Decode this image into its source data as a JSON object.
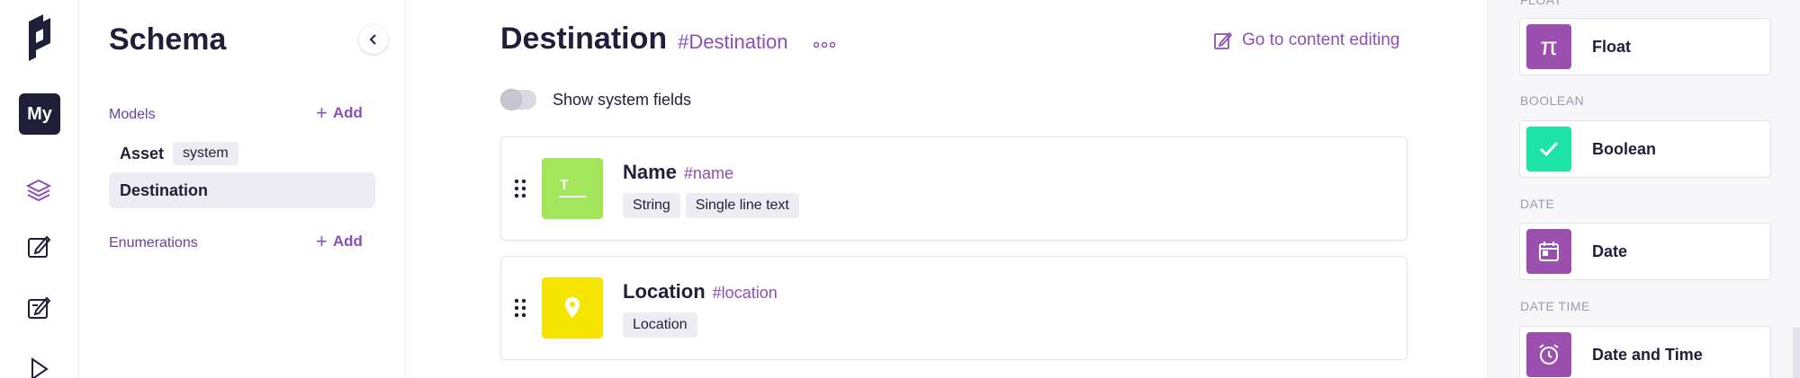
{
  "project": {
    "avatar_text": "My"
  },
  "schema": {
    "title": "Schema",
    "models_label": "Models",
    "enumerations_label": "Enumerations",
    "add_label": "Add",
    "models": [
      {
        "name": "Asset",
        "badge": "system",
        "active": false
      },
      {
        "name": "Destination",
        "badge": "",
        "active": true
      }
    ]
  },
  "main": {
    "title": "Destination",
    "api_id": "#Destination",
    "goto_label": "Go to content editing",
    "toggle_label": "Show system fields",
    "fields": [
      {
        "name": "Name",
        "api_id": "#name",
        "tags": [
          "String",
          "Single line text"
        ],
        "icon": "text-icon",
        "color": "#a3e65b"
      },
      {
        "name": "Location",
        "api_id": "#location",
        "tags": [
          "Location"
        ],
        "icon": "map-pin-icon",
        "color": "#f5e400"
      }
    ]
  },
  "right_panel": {
    "groups": [
      {
        "label": "FLOAT",
        "item": "Float",
        "icon": "pi-icon",
        "color": "#9b4fae"
      },
      {
        "label": "BOOLEAN",
        "item": "Boolean",
        "icon": "check-icon",
        "color": "#1ee3a7"
      },
      {
        "label": "DATE",
        "item": "Date",
        "icon": "calendar-icon",
        "color": "#9b4fae"
      },
      {
        "label": "DATE TIME",
        "item": "Date and Time",
        "icon": "alarm-clock-icon",
        "color": "#9b4fae"
      }
    ]
  },
  "colors": {
    "accent": "#8a4fb8",
    "dark": "#1f1f3a",
    "muted_bg": "#ececf2"
  }
}
